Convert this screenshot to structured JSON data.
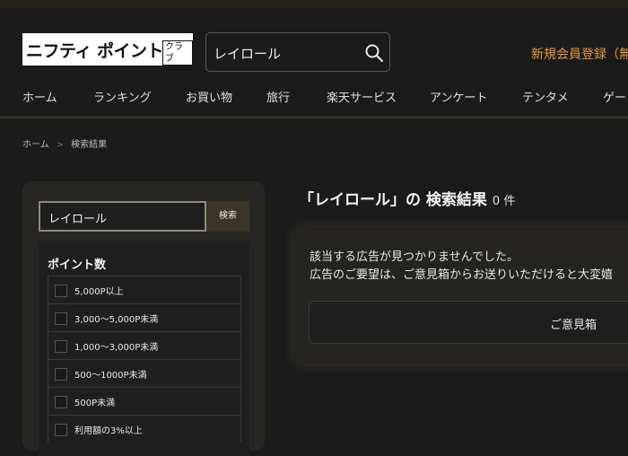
{
  "header": {
    "logo_main": "ニフティ ポイント",
    "logo_sub": "クラブ",
    "search_value": "レイロール",
    "register_link": "新規会員登録（無"
  },
  "nav": {
    "items": [
      "ホーム",
      "ランキング",
      "お買い物",
      "旅行",
      "楽天サービス",
      "アンケート",
      "テンタメ",
      "ゲー"
    ]
  },
  "breadcrumb": {
    "home": "ホーム",
    "separator": ">",
    "current": "検索結果"
  },
  "sidebar": {
    "search_value": "レイロール",
    "search_button": "検索",
    "filter_title": "ポイント数",
    "options": [
      "5,000P以上",
      "3,000～5,000P未満",
      "1,000～3,000P未満",
      "500～1000P未満",
      "500P未満",
      "利用額の3%以上"
    ]
  },
  "results": {
    "title": "「レイロール」の 検索結果",
    "count": "0 件",
    "notice_line1": "該当する広告が見つかりませんでした。",
    "notice_line2": "広告のご要望は、ご意見箱からお送りいただけると大変嬉",
    "opinion_button": "ご意見箱"
  },
  "colors": {
    "accent_orange": "#e59a3c",
    "background": "#1b1b1b",
    "panel": "#272622"
  }
}
